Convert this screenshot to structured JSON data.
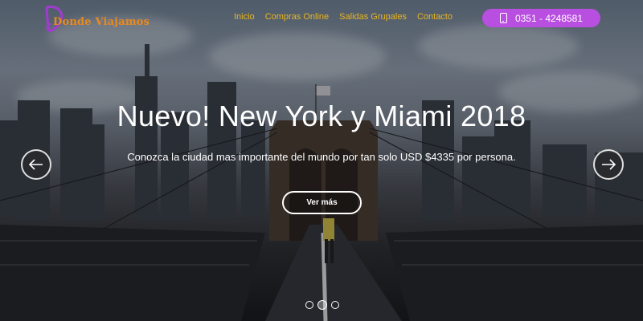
{
  "brand": {
    "name": "Donde Viajamos",
    "color": "#e98a1f",
    "mark_color": "#a23ad1"
  },
  "nav": {
    "items": [
      "Inicio",
      "Compras Online",
      "Salidas Grupales",
      "Contacto"
    ],
    "color": "#e9b520"
  },
  "contact": {
    "phone": "0351 - 4248581",
    "icon": "phone-icon",
    "bg_color": "#b84fe0"
  },
  "carousel": {
    "title": "Nuevo! New York y Miami 2018",
    "subtitle": "Conozca la ciudad mas importante del mundo por tan solo USD $4335 por persona.",
    "cta_label": "Ver más",
    "prev_icon": "arrow-left-icon",
    "next_icon": "arrow-right-icon",
    "slide_count": 3,
    "active_slide": 2
  }
}
